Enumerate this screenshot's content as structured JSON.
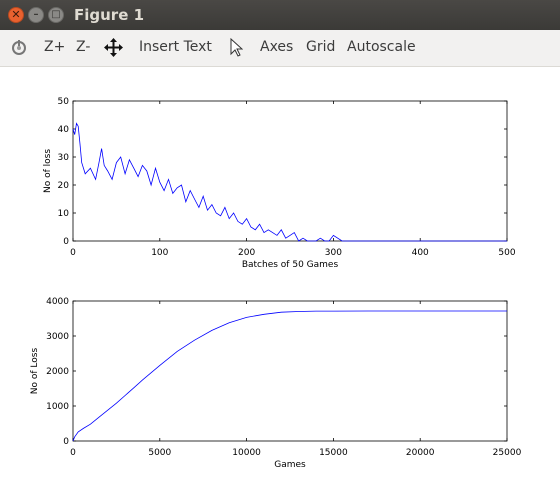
{
  "window": {
    "title": "Figure 1"
  },
  "toolbar": {
    "zoom_in": "Z+",
    "zoom_out": "Z-",
    "insert_text": "Insert Text",
    "axes": "Axes",
    "grid": "Grid",
    "autoscale": "Autoscale"
  },
  "icons": [
    "rotate-icon",
    "pan-icon",
    "pointer-icon"
  ],
  "chart_data": [
    {
      "type": "line",
      "xlabel": "Batches of 50 Games",
      "ylabel": "No of loss",
      "xlim": [
        0,
        500
      ],
      "ylim": [
        0,
        50
      ],
      "xticks": [
        0,
        100,
        200,
        300,
        400,
        500
      ],
      "yticks": [
        0,
        10,
        20,
        30,
        40,
        50
      ],
      "color": "#0000ff",
      "series": [
        {
          "x": [
            0,
            2,
            4,
            6,
            8,
            10,
            14,
            20,
            26,
            30,
            33,
            36,
            40,
            45,
            50,
            55,
            60,
            65,
            70,
            75,
            80,
            85,
            90,
            95,
            100,
            105,
            110,
            115,
            120,
            125,
            130,
            135,
            140,
            145,
            150,
            155,
            160,
            165,
            170,
            175,
            180,
            185,
            190,
            195,
            200,
            205,
            210,
            215,
            220,
            225,
            230,
            235,
            240,
            245,
            250,
            255,
            260,
            265,
            270,
            275,
            280,
            285,
            290,
            295,
            300,
            310,
            320,
            340,
            360,
            380,
            400,
            420,
            440,
            460,
            480,
            500
          ],
          "y": [
            40,
            38,
            42,
            41,
            35,
            28,
            24,
            26,
            22,
            28,
            33,
            27,
            25,
            22,
            28,
            30,
            24,
            29,
            26,
            23,
            27,
            25,
            20,
            26,
            21,
            18,
            22,
            17,
            19,
            20,
            14,
            18,
            15,
            12,
            16,
            11,
            13,
            10,
            9,
            12,
            8,
            10,
            7,
            6,
            8,
            5,
            4,
            6,
            3,
            4,
            3,
            2,
            4,
            1,
            2,
            3,
            0,
            1,
            0,
            0,
            0,
            1,
            0,
            0,
            2,
            0,
            0,
            0,
            0,
            0,
            0,
            0,
            0,
            0,
            0,
            0
          ]
        }
      ]
    },
    {
      "type": "line",
      "xlabel": "Games",
      "ylabel": "No of Loss",
      "xlim": [
        0,
        25000
      ],
      "ylim": [
        0,
        4000
      ],
      "xticks": [
        0,
        5000,
        10000,
        15000,
        20000,
        25000
      ],
      "yticks": [
        0,
        1000,
        2000,
        3000,
        4000
      ],
      "color": "#0000ff",
      "series": [
        {
          "x": [
            0,
            100,
            300,
            600,
            1000,
            1500,
            2000,
            2500,
            3000,
            3500,
            4000,
            5000,
            6000,
            7000,
            8000,
            9000,
            10000,
            11000,
            12000,
            13000,
            14000,
            15000,
            17000,
            20000,
            25000
          ],
          "y": [
            0,
            120,
            260,
            360,
            480,
            680,
            880,
            1080,
            1300,
            1520,
            1740,
            2160,
            2560,
            2880,
            3160,
            3380,
            3530,
            3620,
            3680,
            3700,
            3710,
            3712,
            3715,
            3715,
            3715
          ]
        }
      ]
    }
  ]
}
